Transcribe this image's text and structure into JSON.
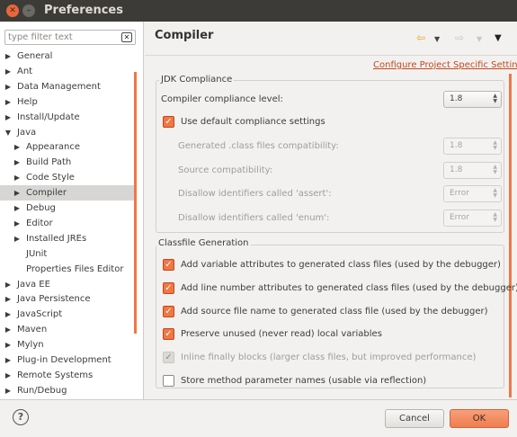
{
  "window": {
    "title": "Preferences"
  },
  "filter": {
    "placeholder": "type filter text"
  },
  "tree": [
    {
      "label": "General",
      "expanded": false,
      "level": 0,
      "has_children": true
    },
    {
      "label": "Ant",
      "expanded": false,
      "level": 0,
      "has_children": true
    },
    {
      "label": "Data Management",
      "expanded": false,
      "level": 0,
      "has_children": true
    },
    {
      "label": "Help",
      "expanded": false,
      "level": 0,
      "has_children": true
    },
    {
      "label": "Install/Update",
      "expanded": false,
      "level": 0,
      "has_children": true
    },
    {
      "label": "Java",
      "expanded": true,
      "level": 0,
      "has_children": true
    },
    {
      "label": "Appearance",
      "expanded": false,
      "level": 1,
      "has_children": true
    },
    {
      "label": "Build Path",
      "expanded": false,
      "level": 1,
      "has_children": true
    },
    {
      "label": "Code Style",
      "expanded": false,
      "level": 1,
      "has_children": true
    },
    {
      "label": "Compiler",
      "expanded": false,
      "level": 1,
      "has_children": true,
      "selected": true
    },
    {
      "label": "Debug",
      "expanded": false,
      "level": 1,
      "has_children": true
    },
    {
      "label": "Editor",
      "expanded": false,
      "level": 1,
      "has_children": true
    },
    {
      "label": "Installed JREs",
      "expanded": false,
      "level": 1,
      "has_children": true
    },
    {
      "label": "JUnit",
      "expanded": false,
      "level": 1,
      "has_children": false
    },
    {
      "label": "Properties Files Editor",
      "expanded": false,
      "level": 1,
      "has_children": false
    },
    {
      "label": "Java EE",
      "expanded": false,
      "level": 0,
      "has_children": true
    },
    {
      "label": "Java Persistence",
      "expanded": false,
      "level": 0,
      "has_children": true
    },
    {
      "label": "JavaScript",
      "expanded": false,
      "level": 0,
      "has_children": true
    },
    {
      "label": "Maven",
      "expanded": false,
      "level": 0,
      "has_children": true
    },
    {
      "label": "Mylyn",
      "expanded": false,
      "level": 0,
      "has_children": true
    },
    {
      "label": "Plug-in Development",
      "expanded": false,
      "level": 0,
      "has_children": true
    },
    {
      "label": "Remote Systems",
      "expanded": false,
      "level": 0,
      "has_children": true
    },
    {
      "label": "Run/Debug",
      "expanded": false,
      "level": 0,
      "has_children": true
    }
  ],
  "page": {
    "title": "Compiler",
    "configure_link": "Configure Project Specific Settings..."
  },
  "jdk": {
    "group_label": "JDK Compliance",
    "compliance_label": "Compiler compliance level:",
    "compliance_value": "1.8",
    "use_default_label": "Use default compliance settings",
    "use_default_checked": true,
    "generated_label": "Generated .class files compatibility:",
    "generated_value": "1.8",
    "source_label": "Source compatibility:",
    "source_value": "1.8",
    "assert_label": "Disallow identifiers called 'assert':",
    "assert_value": "Error",
    "enum_label": "Disallow identifiers called 'enum':",
    "enum_value": "Error"
  },
  "classfile": {
    "group_label": "Classfile Generation",
    "options": [
      {
        "label": "Add variable attributes to generated class files (used by the debugger)",
        "checked": true,
        "enabled": true
      },
      {
        "label": "Add line number attributes to generated class files (used by the debugger)",
        "checked": true,
        "enabled": true
      },
      {
        "label": "Add source file name to generated class file (used by the debugger)",
        "checked": true,
        "enabled": true
      },
      {
        "label": "Preserve unused (never read) local variables",
        "checked": true,
        "enabled": true
      },
      {
        "label": "Inline finally blocks (larger class files, but improved performance)",
        "checked": true,
        "enabled": false
      },
      {
        "label": "Store method parameter names (usable via reflection)",
        "checked": false,
        "enabled": true
      }
    ]
  },
  "buttons": {
    "cancel": "Cancel",
    "ok": "OK"
  },
  "icons": {
    "close": "close-icon",
    "minimize": "minimize-icon",
    "clear": "clear-filter-icon",
    "back": "back-arrow-icon",
    "forward": "forward-arrow-icon",
    "menu": "view-menu-icon",
    "help": "help-icon",
    "tree_collapsed": "triangle-right-icon",
    "tree_expanded": "triangle-down-icon"
  },
  "colors": {
    "accent": "#f07746",
    "link": "#c4481d",
    "titlebar": "#3c3b37"
  }
}
